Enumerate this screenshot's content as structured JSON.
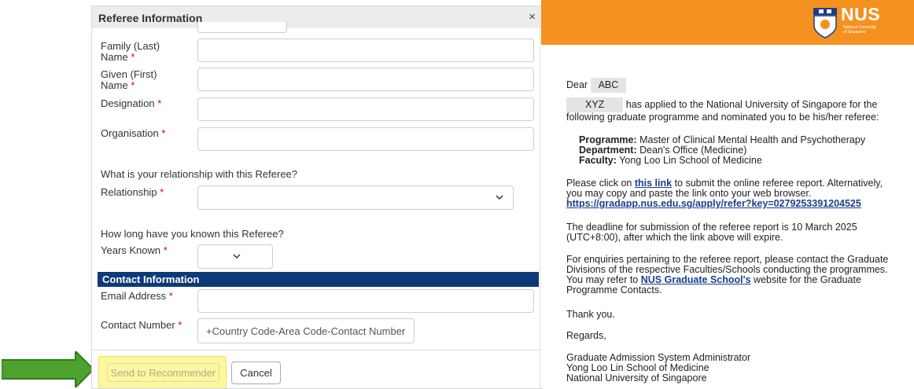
{
  "modal": {
    "title": "Referee Information",
    "close_symbol": "×",
    "required_mark": "*",
    "fields": {
      "family_name_line1": "Family (Last)",
      "family_name_line2": "Name",
      "given_name_line1": "Given (First)",
      "given_name_line2": "Name",
      "designation": "Designation",
      "organisation": "Organisation",
      "relationship": "Relationship",
      "years_known": "Years Known",
      "email": "Email Address",
      "contact_number": "Contact Number"
    },
    "relationship_question": "What is your relationship with this Referee?",
    "years_question": "How long have you known this Referee?",
    "contact_section": "Contact Information",
    "contact_placeholder": "+Country Code-Area Code-Contact Number",
    "send_button": "Send to Recommender",
    "cancel_button": "Cancel",
    "highlight_color": "#fbf7a2",
    "section_color": "#0c3a78"
  },
  "arrow": {
    "icon": "green-arrow-icon",
    "color": "#4ca22c"
  },
  "email": {
    "header_color": "#f5911f",
    "logo": {
      "text": "NUS",
      "subtitle_line1": "National University",
      "subtitle_line2": "of Singapore"
    },
    "salutation": "Dear",
    "recipient_name": "ABC",
    "applicant_name": "XYZ",
    "intro_line1": "has applied to the National University of Singapore for the",
    "intro_line2": "following graduate programme and nominated you to be his/her referee:",
    "programme_label": "Programme:",
    "programme_value": "Master of Clinical Mental Health and Psychotherapy",
    "department_label": "Department:",
    "department_value": "Dean's Office (Medicine)",
    "faculty_label": "Faculty:",
    "faculty_value": "Yong Loo Lin School of Medicine",
    "click_pre": "Please click on",
    "click_link": "this link",
    "click_post": "to submit the online referee report. Alternatively,",
    "click_line2": "you may copy and paste the link onto your web browser.",
    "url": "https://gradapp.nus.edu.sg/apply/refer?key=0279253391204525",
    "deadline_line1": "The deadline for submission of the referee report is 10 March 2025",
    "deadline_line2": "(UTC+8:00), after which the link above will expire.",
    "enq_line1": "For enquiries pertaining to the referee report, please contact the Graduate",
    "enq_line2": "Divisions of the respective Faculties/Schools conducting the programmes.",
    "enq_line3_pre": "You may refer to",
    "enq_link": "NUS Graduate School's",
    "enq_line3_post": "website for the Graduate",
    "enq_line4": "Programme Contacts.",
    "thanks": "Thank you.",
    "regards": "Regards,",
    "sig1": "Graduate Admission System Administrator",
    "sig2": "Yong Loo Lin School of Medicine",
    "sig3": "National University of Singapore"
  }
}
